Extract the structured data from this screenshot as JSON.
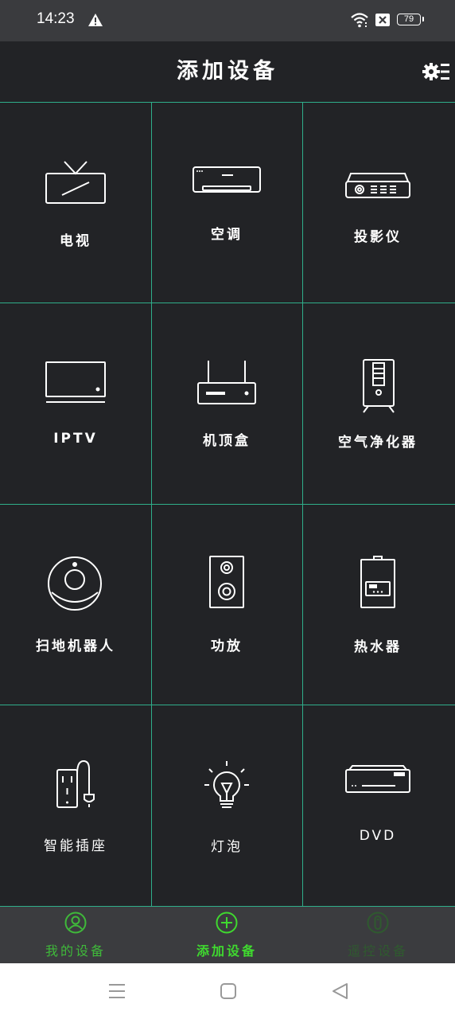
{
  "status_bar": {
    "time": "14:23",
    "battery": "79"
  },
  "header": {
    "title": "添加设备"
  },
  "devices": [
    {
      "label": "电视",
      "icon": "tv-icon"
    },
    {
      "label": "空调",
      "icon": "air-conditioner-icon"
    },
    {
      "label": "投影仪",
      "icon": "projector-icon"
    },
    {
      "label": "IPTV",
      "icon": "iptv-icon"
    },
    {
      "label": "机顶盒",
      "icon": "set-top-box-icon"
    },
    {
      "label": "空气净化器",
      "icon": "air-purifier-icon"
    },
    {
      "label": "扫地机器人",
      "icon": "robot-vacuum-icon"
    },
    {
      "label": "功放",
      "icon": "speaker-icon"
    },
    {
      "label": "热水器",
      "icon": "water-heater-icon"
    },
    {
      "label": "智能插座",
      "icon": "smart-socket-icon"
    },
    {
      "label": "灯泡",
      "icon": "light-bulb-icon"
    },
    {
      "label": "DVD",
      "icon": "dvd-player-icon"
    }
  ],
  "tabs": [
    {
      "label": "我的设备",
      "icon": "user-circle-icon",
      "color": "#3fb93a"
    },
    {
      "label": "添加设备",
      "icon": "plus-circle-icon",
      "color": "#3fd92f",
      "active": true
    },
    {
      "label": "遥控设备",
      "icon": "remote-icon",
      "color": "#2f5a2f"
    }
  ],
  "colors": {
    "background": "#222326",
    "grid_line": "#2fae8a",
    "tab_bar": "#3b3c3f",
    "accent_green": "#3fd92f"
  }
}
